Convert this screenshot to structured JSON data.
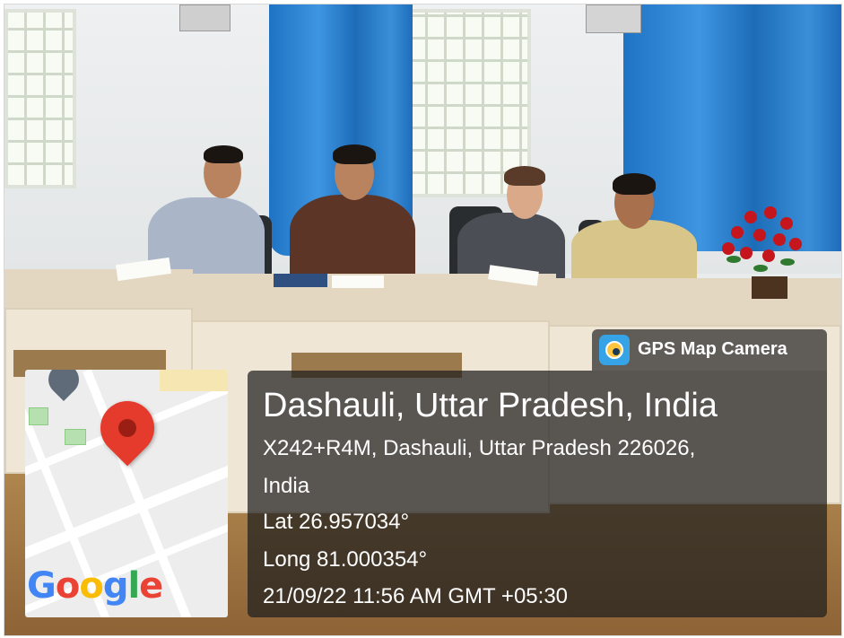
{
  "overlay": {
    "app_name": "GPS Map Camera",
    "logo_icon": "gps-map-camera-logo-icon",
    "location_title": "Dashauli, Uttar Pradesh, India",
    "address_line1": "X242+R4M, Dashauli, Uttar Pradesh 226026,",
    "address_line2": "India",
    "latitude": "Lat 26.957034°",
    "longitude": "Long 81.000354°",
    "datetime": "21/09/22 11:56 AM GMT +05:30"
  },
  "map": {
    "brand": "Google",
    "pin_icon": "map-pin-icon",
    "pin_color": "#e53b2d"
  },
  "colors": {
    "curtain": "#2f86d6",
    "overlay_bg": "#1e1e1e",
    "desk": "#e4d7c1"
  }
}
